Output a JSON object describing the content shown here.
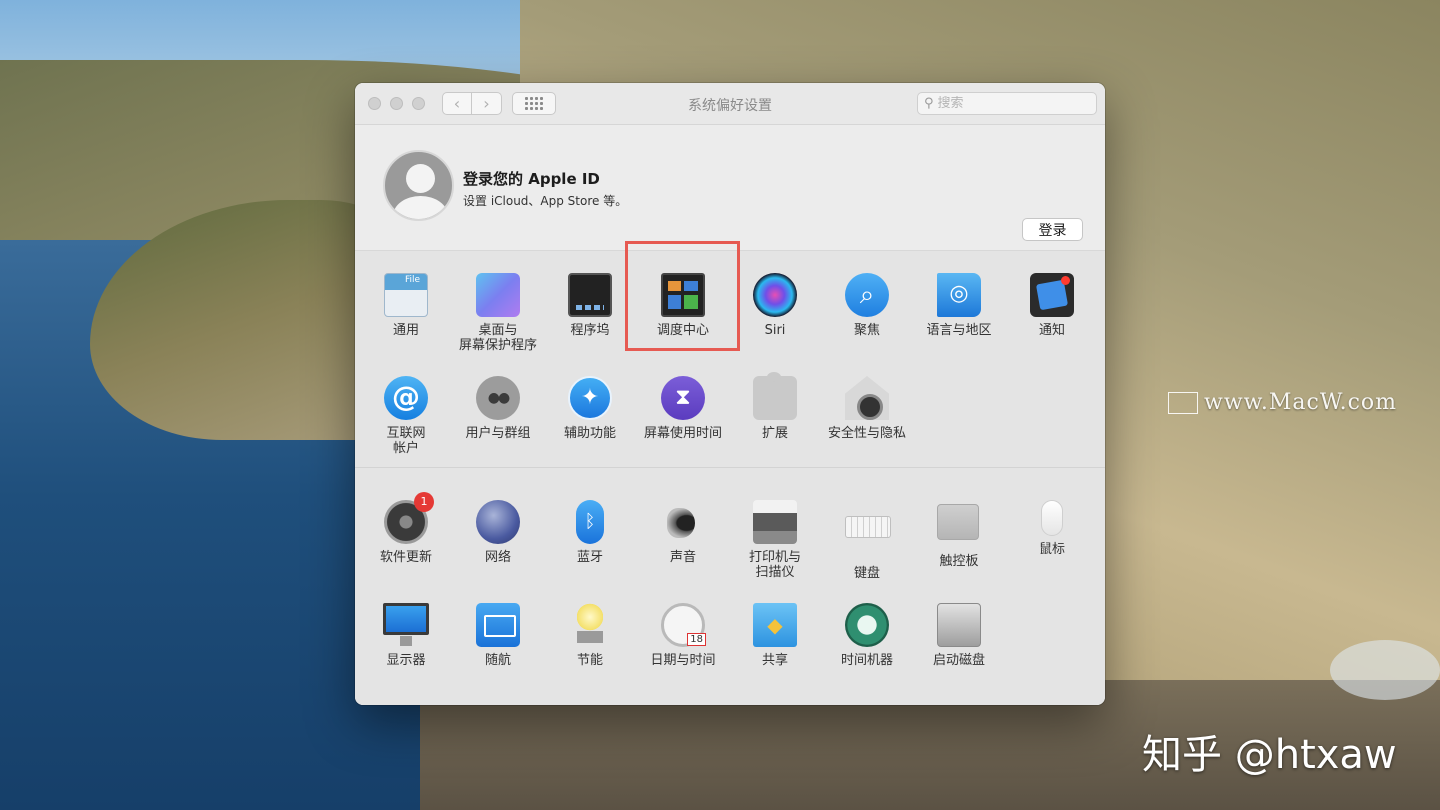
{
  "window": {
    "title": "系统偏好设置",
    "nav": {
      "back_icon": "chevron-left-icon",
      "forward_icon": "chevron-right-icon",
      "grid_icon": "grid-icon"
    },
    "search": {
      "placeholder": "搜索",
      "value": ""
    }
  },
  "account": {
    "title": "登录您的 Apple ID",
    "subtitle": "设置 iCloud、App Store 等。",
    "login_button": "登录"
  },
  "panes_top": [
    {
      "label": "通用",
      "icon": "general-icon"
    },
    {
      "label": "桌面与\n屏幕保护程序",
      "icon": "desktop-screensaver-icon"
    },
    {
      "label": "程序坞",
      "icon": "dock-icon"
    },
    {
      "label": "调度中心",
      "icon": "mission-control-icon"
    },
    {
      "label": "Siri",
      "icon": "siri-icon"
    },
    {
      "label": "聚焦",
      "icon": "spotlight-icon"
    },
    {
      "label": "语言与地区",
      "icon": "language-region-icon"
    },
    {
      "label": "通知",
      "icon": "notifications-icon"
    },
    {
      "label": "互联网\n帐户",
      "icon": "internet-accounts-icon"
    },
    {
      "label": "用户与群组",
      "icon": "users-groups-icon"
    },
    {
      "label": "辅助功能",
      "icon": "accessibility-icon"
    },
    {
      "label": "屏幕使用时间",
      "icon": "screen-time-icon"
    },
    {
      "label": "扩展",
      "icon": "extensions-icon"
    },
    {
      "label": "安全性与隐私",
      "icon": "security-privacy-icon"
    }
  ],
  "panes_bottom": [
    {
      "label": "软件更新",
      "icon": "software-update-icon",
      "badge": "1"
    },
    {
      "label": "网络",
      "icon": "network-icon"
    },
    {
      "label": "蓝牙",
      "icon": "bluetooth-icon"
    },
    {
      "label": "声音",
      "icon": "sound-icon"
    },
    {
      "label": "打印机与\n扫描仪",
      "icon": "printer-scanner-icon"
    },
    {
      "label": "键盘",
      "icon": "keyboard-icon"
    },
    {
      "label": "触控板",
      "icon": "trackpad-icon"
    },
    {
      "label": "鼠标",
      "icon": "mouse-icon"
    },
    {
      "label": "显示器",
      "icon": "displays-icon"
    },
    {
      "label": "随航",
      "icon": "sidecar-icon"
    },
    {
      "label": "节能",
      "icon": "energy-saver-icon"
    },
    {
      "label": "日期与时间",
      "icon": "date-time-icon"
    },
    {
      "label": "共享",
      "icon": "sharing-icon"
    },
    {
      "label": "时间机器",
      "icon": "time-machine-icon"
    },
    {
      "label": "启动磁盘",
      "icon": "startup-disk-icon"
    }
  ],
  "overlay": {
    "watermark": "www.MacW.com",
    "credit": "知乎 @htxaw",
    "highlight_color": "#e65a52"
  }
}
